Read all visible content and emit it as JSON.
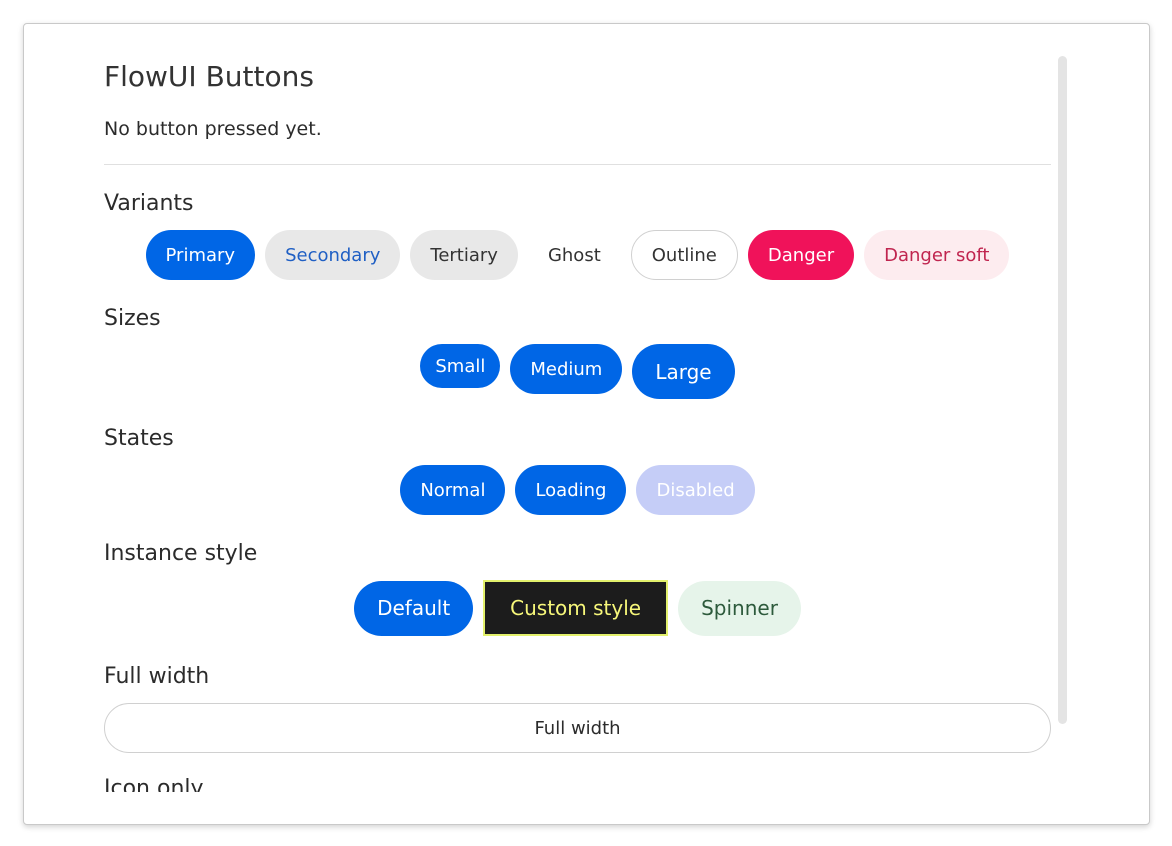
{
  "app": {
    "title": "FlowUI Buttons",
    "status": "No button pressed yet."
  },
  "sections": {
    "variants": {
      "title": "Variants",
      "buttons": [
        "Primary",
        "Secondary",
        "Tertiary",
        "Ghost",
        "Outline",
        "Danger",
        "Danger soft"
      ]
    },
    "sizes": {
      "title": "Sizes",
      "buttons": [
        "Small",
        "Medium",
        "Large"
      ]
    },
    "states": {
      "title": "States",
      "buttons": [
        "Normal",
        "Loading",
        "Disabled"
      ]
    },
    "instance_style": {
      "title": "Instance style",
      "buttons": [
        "Default",
        "Custom style",
        "Spinner"
      ]
    },
    "full_width": {
      "title": "Full width",
      "button": "Full width"
    },
    "icon_only": {
      "title": "Icon only"
    }
  },
  "colors": {
    "primary": "#0066e6",
    "danger": "#f0125a",
    "disabled": "#c5cdf7",
    "custom_bg": "#1c1c1c",
    "custom_text": "#f7f77a"
  }
}
